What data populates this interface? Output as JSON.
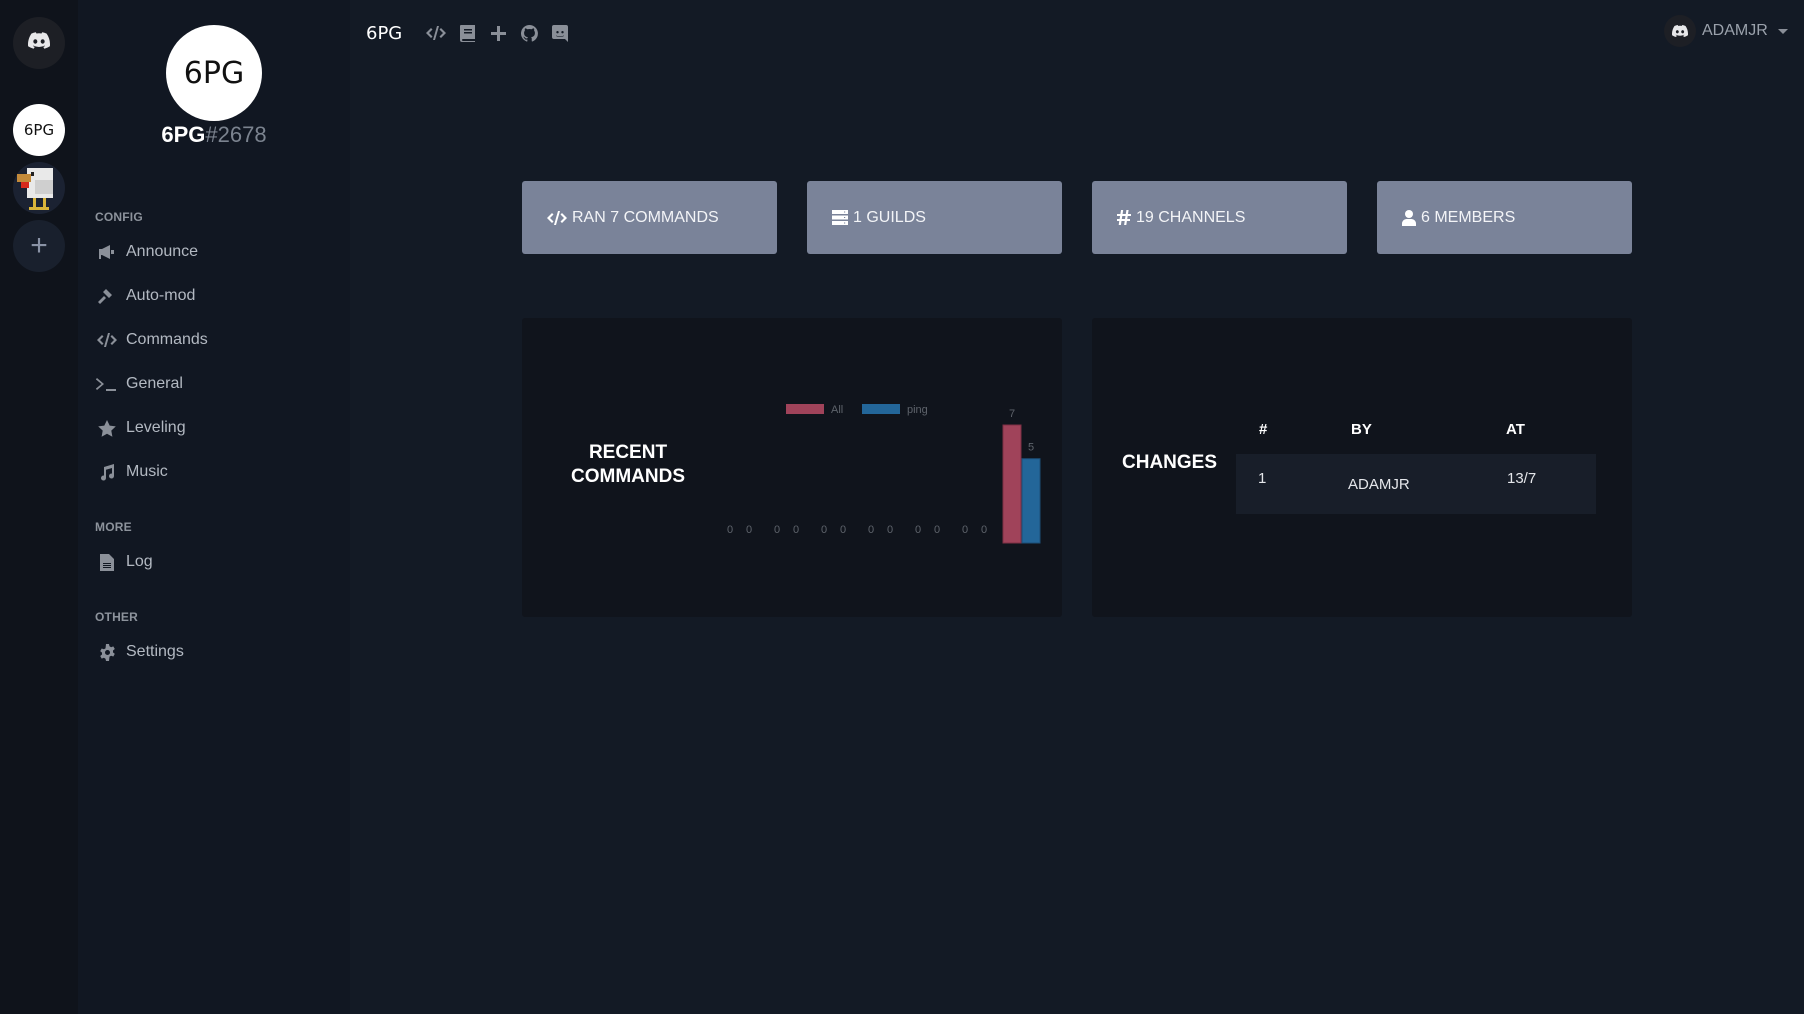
{
  "guild_bar": {
    "items": [
      {
        "name": "discord-home",
        "icon": "discord-icon"
      },
      {
        "name": "6PG",
        "label": "6PG"
      },
      {
        "name": "chicken-server",
        "icon": "chicken-avatar"
      },
      {
        "name": "add-server",
        "label": "+"
      }
    ]
  },
  "sidebar": {
    "bot": {
      "avatar_label": "6PG",
      "name": "6PG",
      "discriminator": "#2678"
    },
    "sections": [
      {
        "title": "CONFIG",
        "items": [
          {
            "label": "Announce",
            "icon": "megaphone-icon"
          },
          {
            "label": "Auto-mod",
            "icon": "gavel-icon"
          },
          {
            "label": "Commands",
            "icon": "code-icon"
          },
          {
            "label": "General",
            "icon": "terminal-icon"
          },
          {
            "label": "Leveling",
            "icon": "star-icon"
          },
          {
            "label": "Music",
            "icon": "music-icon"
          }
        ]
      },
      {
        "title": "MORE",
        "items": [
          {
            "label": "Log",
            "icon": "file-icon"
          }
        ]
      },
      {
        "title": "OTHER",
        "items": [
          {
            "label": "Settings",
            "icon": "gear-icon"
          }
        ]
      }
    ]
  },
  "topnav": {
    "brand": "6PG",
    "icons": [
      "code-icon",
      "book-icon",
      "plus-icon",
      "github-icon",
      "discord-icon"
    ]
  },
  "user": {
    "name": "ADAMJR"
  },
  "stats": [
    {
      "label": "RAN 7 COMMANDS",
      "icon": "code-icon"
    },
    {
      "label": "1 GUILDS",
      "icon": "server-icon"
    },
    {
      "label": "19 CHANNELS",
      "icon": "hashtag-icon"
    },
    {
      "label": "6 MEMBERS",
      "icon": "user-icon"
    }
  ],
  "recent_commands": {
    "title_line1": "RECENT",
    "title_line2": "COMMANDS"
  },
  "chart_data": {
    "type": "bar",
    "title": "RECENT COMMANDS",
    "categories": [
      "",
      "",
      "",
      "",
      "",
      "",
      ""
    ],
    "series": [
      {
        "name": "All",
        "color": "#a0435a",
        "values": [
          0,
          0,
          0,
          0,
          0,
          0,
          7
        ]
      },
      {
        "name": "ping",
        "color": "#236699",
        "values": [
          0,
          0,
          0,
          0,
          0,
          0,
          5
        ]
      }
    ],
    "ylim": [
      0,
      7
    ],
    "legend": "top",
    "grid": false,
    "data_labels": true,
    "xlabel": "",
    "ylabel": ""
  },
  "changes": {
    "title": "CHANGES",
    "columns": [
      "#",
      "BY",
      "AT"
    ],
    "rows": [
      {
        "num": "1",
        "by": "ADAMJR",
        "at": "13/7"
      }
    ]
  }
}
